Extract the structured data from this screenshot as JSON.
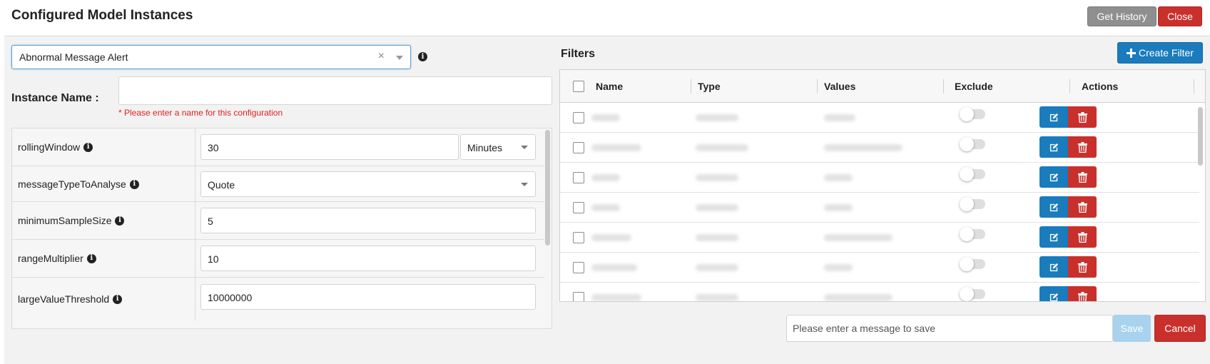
{
  "header": {
    "title": "Configured Model Instances",
    "get_history_label": "Get History",
    "close_label": "Close"
  },
  "model_select": {
    "value": "Abnormal Message Alert",
    "clear_glyph": "×"
  },
  "instance": {
    "label": "Instance Name :",
    "value": "",
    "error": "* Please enter a name for this configuration"
  },
  "params": [
    {
      "name": "rollingWindow",
      "value": "30",
      "unit": "Minutes"
    },
    {
      "name": "messageTypeToAnalyse",
      "value": "Quote"
    },
    {
      "name": "minimumSampleSize",
      "value": "5"
    },
    {
      "name": "rangeMultiplier",
      "value": "10"
    },
    {
      "name": "largeValueThreshold",
      "value": "10000000"
    }
  ],
  "filters": {
    "title": "Filters",
    "create_label": "Create Filter",
    "columns": [
      "Name",
      "Type",
      "Values",
      "Exclude",
      "Actions"
    ],
    "rows": [
      {
        "exclude": false
      },
      {
        "exclude": false
      },
      {
        "exclude": false
      },
      {
        "exclude": false
      },
      {
        "exclude": false
      },
      {
        "exclude": false
      },
      {
        "exclude": false
      }
    ]
  },
  "footer": {
    "message_placeholder": "Please enter a message to save",
    "save_label": "Save",
    "cancel_label": "Cancel"
  },
  "colors": {
    "primary": "#1a7bbd",
    "danger": "#c9302c",
    "error_text": "#e02020"
  },
  "icons": {
    "info": "info-icon",
    "edit": "edit-icon",
    "delete": "trash-icon",
    "plus": "plus-icon"
  }
}
